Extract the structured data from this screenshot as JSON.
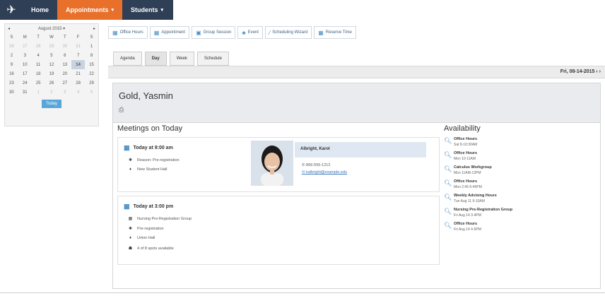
{
  "nav": {
    "items": [
      {
        "label": "Home"
      },
      {
        "label": "Appointments",
        "caret": "▾"
      },
      {
        "label": "Students",
        "caret": "▾"
      }
    ]
  },
  "calendar": {
    "month_label": "August 2015 ▾",
    "prev": "◂",
    "next": "▸",
    "weekdays": [
      "S",
      "M",
      "T",
      "W",
      "T",
      "F",
      "S"
    ],
    "weeks": [
      [
        "26",
        "27",
        "28",
        "29",
        "30",
        "31",
        "1"
      ],
      [
        "2",
        "3",
        "4",
        "5",
        "6",
        "7",
        "8"
      ],
      [
        "9",
        "10",
        "11",
        "12",
        "13",
        "14",
        "15"
      ],
      [
        "16",
        "17",
        "18",
        "19",
        "20",
        "21",
        "22"
      ],
      [
        "23",
        "24",
        "25",
        "26",
        "27",
        "28",
        "29"
      ],
      [
        "30",
        "31",
        "1",
        "2",
        "3",
        "4",
        "5"
      ]
    ],
    "today_day": "14",
    "today_button": "Today"
  },
  "toolbar": {
    "buttons": [
      {
        "label": "Office Hours",
        "icon": "calendar-icon"
      },
      {
        "label": "Appointment",
        "icon": "calendar-icon"
      },
      {
        "label": "Group Session",
        "icon": "group-icon"
      },
      {
        "label": "Event",
        "icon": "event-icon"
      },
      {
        "label": "Scheduling Wizard",
        "icon": "wand-icon"
      },
      {
        "label": "Reserve Time",
        "icon": "calendar-icon"
      }
    ]
  },
  "view_tabs": [
    "Agenda",
    "Day",
    "Week",
    "Schedule"
  ],
  "date_bar": {
    "date": "Fri, 08-14-2015 ‹ ›"
  },
  "student": {
    "name": "Gold, Yasmin"
  },
  "meetings": {
    "title": "Meetings on Today",
    "items": [
      {
        "when": "Today at 9:00 am",
        "rows": [
          "Reason: Pre-registration",
          "New Student Hall"
        ],
        "person": {
          "name": "Albright, Karol",
          "phone": "866-555-1212",
          "email": "kalbright@example.edu"
        }
      },
      {
        "when": "Today at 3:00 pm",
        "rows": [
          "Nursing Pre-Registration Group",
          "Pre-registration",
          "Union Hall",
          "4 of 8 spots available"
        ]
      }
    ]
  },
  "availability": {
    "title": "Availability",
    "items": [
      {
        "title": "Office Hours",
        "sub": "Sat 8-10:30AM"
      },
      {
        "title": "Office Hours",
        "sub": "Mon 10-11AM"
      },
      {
        "title": "Calculus Workgroup",
        "sub": "Mon 11AM-12PM"
      },
      {
        "title": "Office Hours",
        "sub": "Mon 2:45-5:45PM"
      },
      {
        "title": "Weekly Advising Hours",
        "sub": "Tue Aug 11 9-10AM"
      },
      {
        "title": "Nursing Pre-Registration Group",
        "sub": "Fri Aug 14 3-4PM"
      },
      {
        "title": "Office Hours",
        "sub": "Fri Aug 14 4-5PM"
      }
    ]
  },
  "colors": {
    "nav_bg": "#2f3f56",
    "nav_active": "#e8702a",
    "accent": "#4a8ec4",
    "today_button": "#58a6d8"
  }
}
